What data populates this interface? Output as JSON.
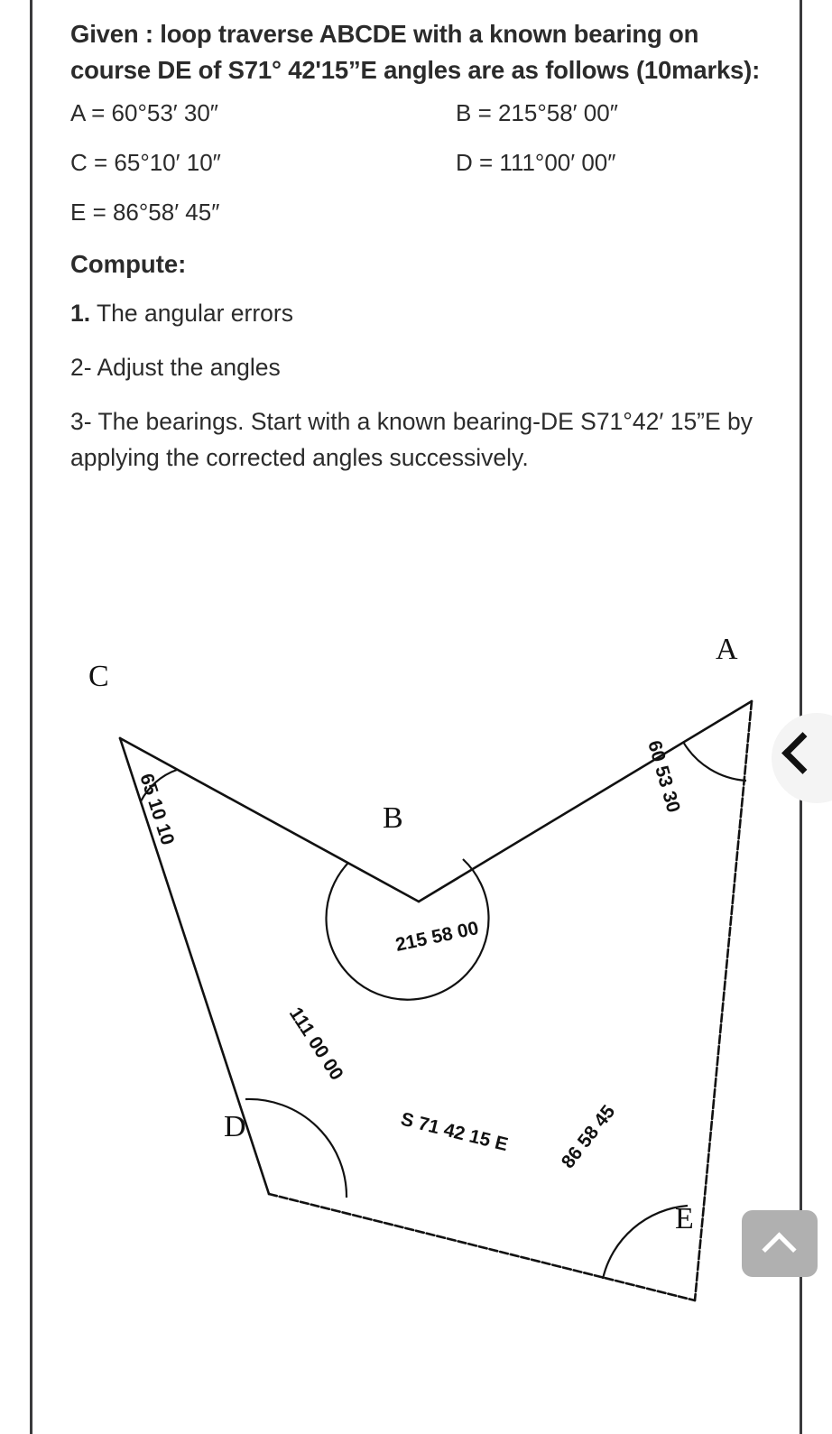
{
  "document": {
    "intro": "Given : loop traverse ABCDE with a known bearing on course DE of S71° 42ʹ15”E angles are as follows (10marks):",
    "angles": [
      {
        "left": "A = 60°53′ 30″",
        "right": "B = 215°58′ 00″"
      },
      {
        "left": "C = 65°10′ 10″",
        "right": "D = 111°00′ 00″"
      },
      {
        "left": "E = 86°58′ 45″",
        "right": ""
      }
    ],
    "compute_heading": "Compute:",
    "steps": [
      {
        "marker": "1.",
        "marker_bold": true,
        "text": " The angular errors"
      },
      {
        "marker": "2-",
        "marker_bold": false,
        "text": " Adjust the angles"
      },
      {
        "marker": "3-",
        "marker_bold": false,
        "text": " The bearings. Start with a known bearing-DE S71°42′ 15”E by applying the corrected angles successively."
      }
    ]
  },
  "diagram": {
    "vertices": {
      "A": "A",
      "B": "B",
      "C": "C",
      "D": "D",
      "E": "E"
    },
    "angle_labels": {
      "C": "65 10 10",
      "A": "60 53 30",
      "B": "215 58 00",
      "D": "111 00 00",
      "E": "86 58 45"
    },
    "bearing_label": "S 71 42 15 E"
  },
  "controls": {
    "prev_label": "chevron-left",
    "scroll_top_label": "chevron-up"
  },
  "colors": {
    "text": "#2b2b2b",
    "ink": "#111111",
    "rule": "#3a3a3c",
    "nav_circle_bg": "#f4f4f4",
    "top_btn_bg": "#b0b0b0"
  }
}
